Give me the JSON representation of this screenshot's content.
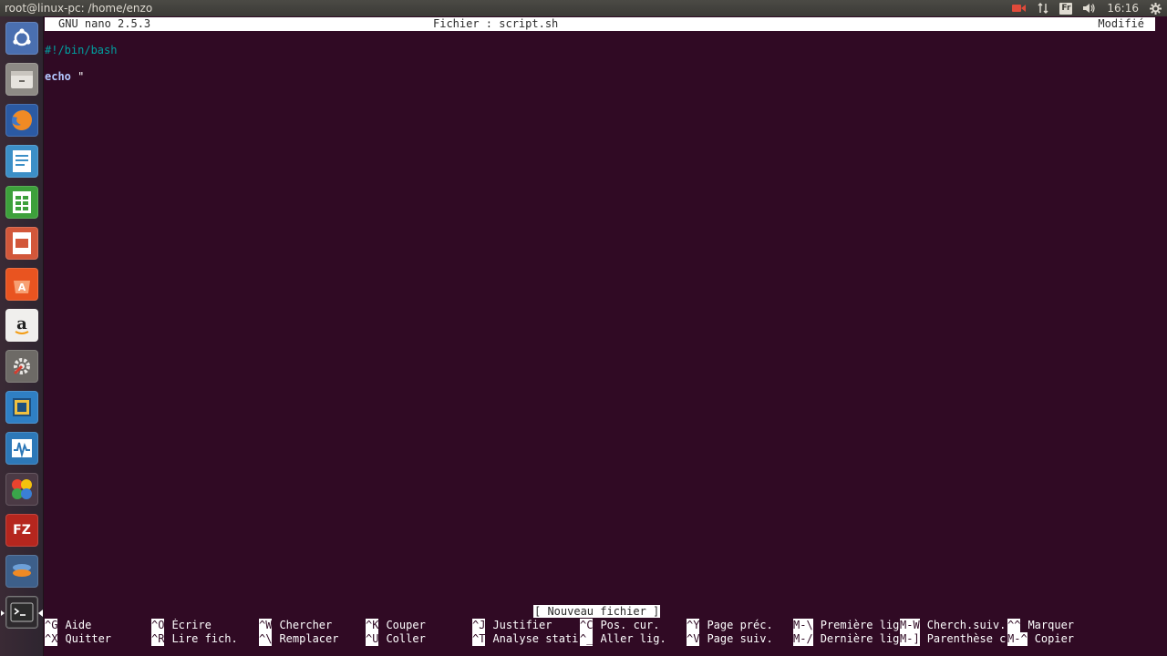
{
  "top_panel": {
    "window_title": "root@linux-pc: /home/enzo",
    "keyboard_layout": "Fr",
    "clock": "16:16",
    "icons": [
      "camera-icon",
      "network-icon",
      "keyboard-layout-icon",
      "volume-icon",
      "settings-icon"
    ]
  },
  "launcher": {
    "items": [
      {
        "name": "dash-home",
        "icon": "ubuntu-logo-icon"
      },
      {
        "name": "files",
        "icon": "file-cabinet-icon"
      },
      {
        "name": "firefox",
        "icon": "firefox-icon"
      },
      {
        "name": "libreoffice-writer",
        "icon": "writer-doc-icon"
      },
      {
        "name": "libreoffice-calc",
        "icon": "calc-sheet-icon"
      },
      {
        "name": "libreoffice-impress",
        "icon": "impress-slide-icon"
      },
      {
        "name": "software-center",
        "icon": "software-bag-icon"
      },
      {
        "name": "amazon",
        "icon": "amazon-icon"
      },
      {
        "name": "system-settings",
        "icon": "settings-wrench-icon"
      },
      {
        "name": "virtualbox",
        "icon": "virtualbox-icon"
      },
      {
        "name": "system-monitor",
        "icon": "monitor-graph-icon"
      },
      {
        "name": "games",
        "icon": "clover-icon"
      },
      {
        "name": "filezilla",
        "icon": "filezilla-icon"
      },
      {
        "name": "terminal",
        "icon": "terminal-icon",
        "active": true
      }
    ]
  },
  "nano": {
    "version": "GNU nano 2.5.3",
    "filename_label": "Fichier : script.sh",
    "status": "Modifié",
    "lines": {
      "shebang": "#!/bin/bash",
      "echo_keyword": "echo",
      "echo_rest": " \""
    },
    "message": "[ Nouveau fichier ]",
    "shortcuts": [
      {
        "key": "^G",
        "label": "Aide"
      },
      {
        "key": "^O",
        "label": "Écrire"
      },
      {
        "key": "^W",
        "label": "Chercher"
      },
      {
        "key": "^K",
        "label": "Couper"
      },
      {
        "key": "^J",
        "label": "Justifier"
      },
      {
        "key": "^C",
        "label": "Pos. cur."
      },
      {
        "key": "^Y",
        "label": "Page préc."
      },
      {
        "key": "M-\\",
        "label": "Première lig"
      },
      {
        "key": "M-W",
        "label": "Cherch.suiv."
      },
      {
        "key": "^^",
        "label": "Marquer"
      },
      {
        "key": "^X",
        "label": "Quitter"
      },
      {
        "key": "^R",
        "label": "Lire fich."
      },
      {
        "key": "^\\",
        "label": "Remplacer"
      },
      {
        "key": "^U",
        "label": "Coller"
      },
      {
        "key": "^T",
        "label": "Analyse stati"
      },
      {
        "key": "^_",
        "label": "Aller lig."
      },
      {
        "key": "^V",
        "label": "Page suiv."
      },
      {
        "key": "M-/",
        "label": "Dernière lig"
      },
      {
        "key": "M-]",
        "label": "Parenthèse c"
      },
      {
        "key": "M-^",
        "label": "Copier"
      }
    ]
  },
  "colors": {
    "terminal_bg": "#300a24",
    "panel_bg": "#3b3a36",
    "shebang": "#00a0a0",
    "accent_orange": "#e95420"
  }
}
